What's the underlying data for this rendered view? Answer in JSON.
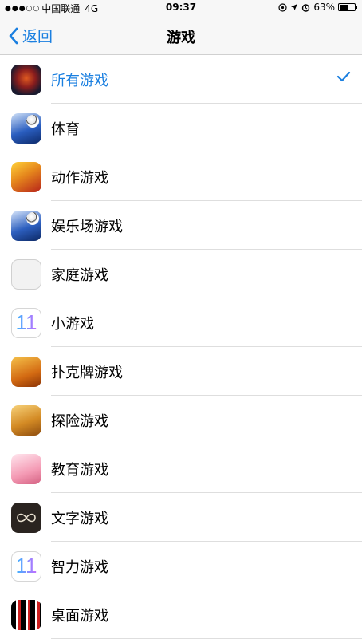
{
  "status_bar": {
    "signal": "●●●○○",
    "carrier": "中国联通",
    "network": "4G",
    "time": "09:37",
    "icons": [
      "location-lock-icon",
      "location-arrow-icon",
      "alarm-icon"
    ],
    "battery_percent": "63%",
    "battery_level": 0.63
  },
  "nav": {
    "back_label": "返回",
    "title": "游戏"
  },
  "categories": [
    {
      "label": "所有游戏",
      "icon": "all-games-icon",
      "selected": true
    },
    {
      "label": "体育",
      "icon": "sports-icon"
    },
    {
      "label": "动作游戏",
      "icon": "action-games-icon"
    },
    {
      "label": "娱乐场游戏",
      "icon": "casino-games-icon"
    },
    {
      "label": "家庭游戏",
      "icon": "family-games-icon"
    },
    {
      "label": "小游戏",
      "icon": "mini-games-icon"
    },
    {
      "label": "扑克牌游戏",
      "icon": "card-games-icon"
    },
    {
      "label": "探险游戏",
      "icon": "adventure-games-icon"
    },
    {
      "label": "教育游戏",
      "icon": "educational-games-icon"
    },
    {
      "label": "文字游戏",
      "icon": "word-games-icon"
    },
    {
      "label": "智力游戏",
      "icon": "puzzle-games-icon"
    },
    {
      "label": "桌面游戏",
      "icon": "board-games-icon"
    }
  ],
  "icon_glyphs": {
    "mini": "11",
    "puzzle": "11"
  },
  "colors": {
    "accent": "#1a7fe0",
    "separator": "#dedede",
    "bar_bg": "#f7f7f7"
  }
}
